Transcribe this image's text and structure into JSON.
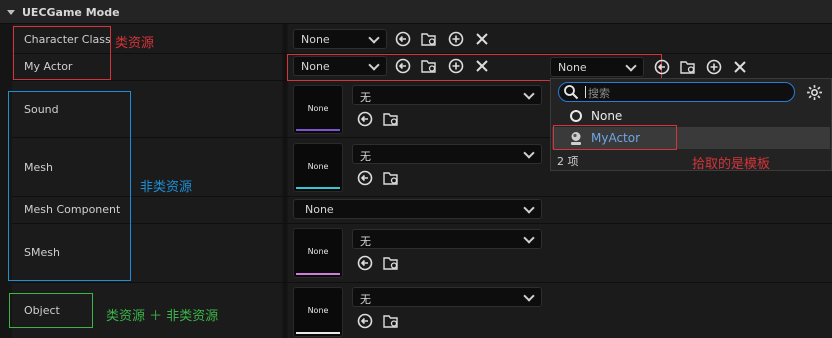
{
  "header": {
    "title": "UECGame Mode"
  },
  "labels": {
    "character_class": "Character Class",
    "my_actor": "My Actor",
    "sound": "Sound",
    "mesh": "Mesh",
    "mesh_component": "Mesh Component",
    "smesh": "SMesh",
    "object": "Object"
  },
  "values": {
    "character_class": "None",
    "my_actor": "None",
    "my_actor_popup": "None",
    "sound": "无",
    "mesh": "无",
    "mesh_component": "None",
    "smesh": "无",
    "object": "无",
    "thumb": "None"
  },
  "annotations": {
    "class_asset": "类资源",
    "non_class_asset": "非类资源",
    "both": "类资源 ＋ 非类资源",
    "template": "拾取的是模板"
  },
  "dropdown": {
    "search_placeholder": "搜索",
    "items": [
      "None",
      "MyActor"
    ],
    "count": "2 项"
  },
  "colors": {
    "accent_red": "#d4343a",
    "accent_blue": "#1c8fd6",
    "accent_green": "#3cb44a",
    "sound_bar": "#7a55d0",
    "mesh_bar": "#36c7d6",
    "smesh_bar": "#d07adc",
    "object_bar": "#e8e8e8"
  }
}
